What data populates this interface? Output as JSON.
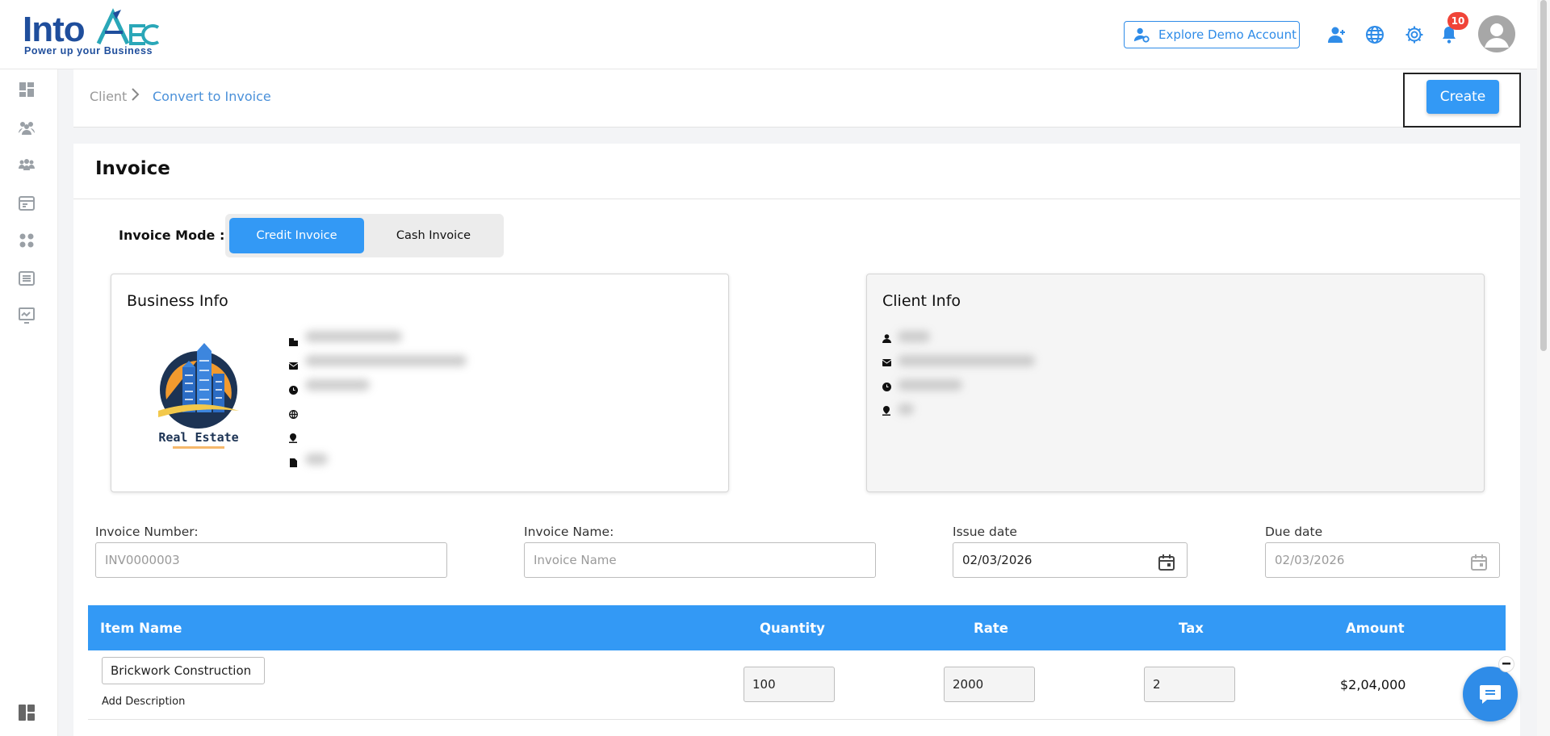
{
  "brand": {
    "name": "Into",
    "tagline": "Power up your Business"
  },
  "header": {
    "demo_label": "Explore Demo Account",
    "notification_count": "10"
  },
  "breadcrumb": {
    "root": "Client",
    "current": "Convert to Invoice"
  },
  "toolbar": {
    "create_label": "Create"
  },
  "invoice": {
    "title": "Invoice",
    "mode_label": "Invoice Mode :",
    "modes": [
      "Credit Invoice",
      "Cash Invoice"
    ],
    "active_mode": "Credit Invoice",
    "business_title": "Business Info",
    "client_title": "Client Info",
    "business_logo_text": "Real Estate",
    "fields": {
      "number_label": "Invoice Number:",
      "number_placeholder": "INV0000003",
      "name_label": "Invoice Name:",
      "name_placeholder": "Invoice Name",
      "issue_label": "Issue date",
      "issue_value": "02/03/2026",
      "due_label": "Due date",
      "due_placeholder": "02/03/2026"
    }
  },
  "items_table": {
    "headers": {
      "item": "Item Name",
      "quantity": "Quantity",
      "rate": "Rate",
      "tax": "Tax",
      "amount": "Amount"
    },
    "rows": [
      {
        "item": "Brickwork Construction",
        "description_link": "Add Description",
        "quantity": "100",
        "rate": "2000",
        "tax": "2",
        "amount": "$2,04,000"
      }
    ]
  },
  "colors": {
    "primary": "#3399f5",
    "brand": "#1f4e9c",
    "badge": "#f04438"
  }
}
